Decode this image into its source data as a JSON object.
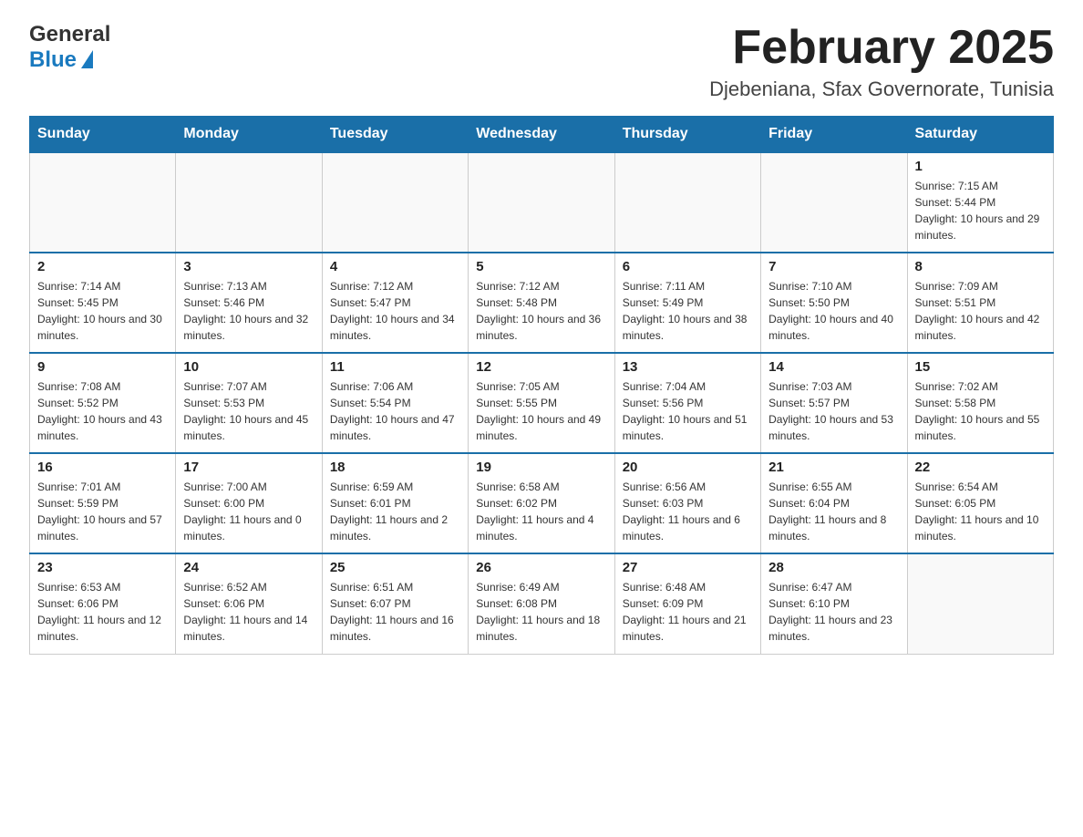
{
  "header": {
    "logo_general": "General",
    "logo_blue": "Blue",
    "title": "February 2025",
    "subtitle": "Djebeniana, Sfax Governorate, Tunisia"
  },
  "calendar": {
    "days_of_week": [
      "Sunday",
      "Monday",
      "Tuesday",
      "Wednesday",
      "Thursday",
      "Friday",
      "Saturday"
    ],
    "weeks": [
      [
        {
          "day": "",
          "info": ""
        },
        {
          "day": "",
          "info": ""
        },
        {
          "day": "",
          "info": ""
        },
        {
          "day": "",
          "info": ""
        },
        {
          "day": "",
          "info": ""
        },
        {
          "day": "",
          "info": ""
        },
        {
          "day": "1",
          "info": "Sunrise: 7:15 AM\nSunset: 5:44 PM\nDaylight: 10 hours and 29 minutes."
        }
      ],
      [
        {
          "day": "2",
          "info": "Sunrise: 7:14 AM\nSunset: 5:45 PM\nDaylight: 10 hours and 30 minutes."
        },
        {
          "day": "3",
          "info": "Sunrise: 7:13 AM\nSunset: 5:46 PM\nDaylight: 10 hours and 32 minutes."
        },
        {
          "day": "4",
          "info": "Sunrise: 7:12 AM\nSunset: 5:47 PM\nDaylight: 10 hours and 34 minutes."
        },
        {
          "day": "5",
          "info": "Sunrise: 7:12 AM\nSunset: 5:48 PM\nDaylight: 10 hours and 36 minutes."
        },
        {
          "day": "6",
          "info": "Sunrise: 7:11 AM\nSunset: 5:49 PM\nDaylight: 10 hours and 38 minutes."
        },
        {
          "day": "7",
          "info": "Sunrise: 7:10 AM\nSunset: 5:50 PM\nDaylight: 10 hours and 40 minutes."
        },
        {
          "day": "8",
          "info": "Sunrise: 7:09 AM\nSunset: 5:51 PM\nDaylight: 10 hours and 42 minutes."
        }
      ],
      [
        {
          "day": "9",
          "info": "Sunrise: 7:08 AM\nSunset: 5:52 PM\nDaylight: 10 hours and 43 minutes."
        },
        {
          "day": "10",
          "info": "Sunrise: 7:07 AM\nSunset: 5:53 PM\nDaylight: 10 hours and 45 minutes."
        },
        {
          "day": "11",
          "info": "Sunrise: 7:06 AM\nSunset: 5:54 PM\nDaylight: 10 hours and 47 minutes."
        },
        {
          "day": "12",
          "info": "Sunrise: 7:05 AM\nSunset: 5:55 PM\nDaylight: 10 hours and 49 minutes."
        },
        {
          "day": "13",
          "info": "Sunrise: 7:04 AM\nSunset: 5:56 PM\nDaylight: 10 hours and 51 minutes."
        },
        {
          "day": "14",
          "info": "Sunrise: 7:03 AM\nSunset: 5:57 PM\nDaylight: 10 hours and 53 minutes."
        },
        {
          "day": "15",
          "info": "Sunrise: 7:02 AM\nSunset: 5:58 PM\nDaylight: 10 hours and 55 minutes."
        }
      ],
      [
        {
          "day": "16",
          "info": "Sunrise: 7:01 AM\nSunset: 5:59 PM\nDaylight: 10 hours and 57 minutes."
        },
        {
          "day": "17",
          "info": "Sunrise: 7:00 AM\nSunset: 6:00 PM\nDaylight: 11 hours and 0 minutes."
        },
        {
          "day": "18",
          "info": "Sunrise: 6:59 AM\nSunset: 6:01 PM\nDaylight: 11 hours and 2 minutes."
        },
        {
          "day": "19",
          "info": "Sunrise: 6:58 AM\nSunset: 6:02 PM\nDaylight: 11 hours and 4 minutes."
        },
        {
          "day": "20",
          "info": "Sunrise: 6:56 AM\nSunset: 6:03 PM\nDaylight: 11 hours and 6 minutes."
        },
        {
          "day": "21",
          "info": "Sunrise: 6:55 AM\nSunset: 6:04 PM\nDaylight: 11 hours and 8 minutes."
        },
        {
          "day": "22",
          "info": "Sunrise: 6:54 AM\nSunset: 6:05 PM\nDaylight: 11 hours and 10 minutes."
        }
      ],
      [
        {
          "day": "23",
          "info": "Sunrise: 6:53 AM\nSunset: 6:06 PM\nDaylight: 11 hours and 12 minutes."
        },
        {
          "day": "24",
          "info": "Sunrise: 6:52 AM\nSunset: 6:06 PM\nDaylight: 11 hours and 14 minutes."
        },
        {
          "day": "25",
          "info": "Sunrise: 6:51 AM\nSunset: 6:07 PM\nDaylight: 11 hours and 16 minutes."
        },
        {
          "day": "26",
          "info": "Sunrise: 6:49 AM\nSunset: 6:08 PM\nDaylight: 11 hours and 18 minutes."
        },
        {
          "day": "27",
          "info": "Sunrise: 6:48 AM\nSunset: 6:09 PM\nDaylight: 11 hours and 21 minutes."
        },
        {
          "day": "28",
          "info": "Sunrise: 6:47 AM\nSunset: 6:10 PM\nDaylight: 11 hours and 23 minutes."
        },
        {
          "day": "",
          "info": ""
        }
      ]
    ]
  }
}
